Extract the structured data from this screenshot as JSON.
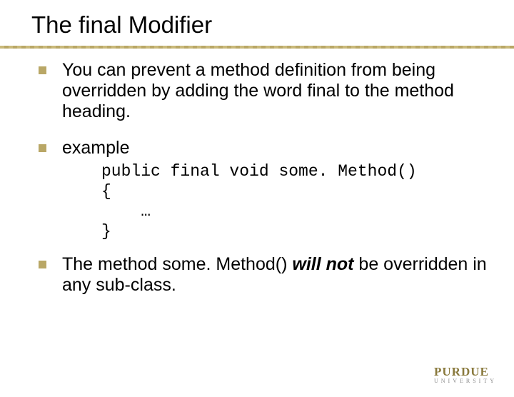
{
  "title": "The final Modifier",
  "bullets": {
    "b0": "You can prevent a method definition from being overridden by adding the word final to the method heading.",
    "b1": "example",
    "b2_pre": "The method some. Method() ",
    "b2_em": "will not",
    "b2_post": " be overridden in any sub-class."
  },
  "code": {
    "l0": "public final void some. Method()",
    "l1": "{",
    "l2": "    …",
    "l3": "}"
  },
  "logo": {
    "name": "PURDUE",
    "sub": "UNIVERSITY"
  }
}
